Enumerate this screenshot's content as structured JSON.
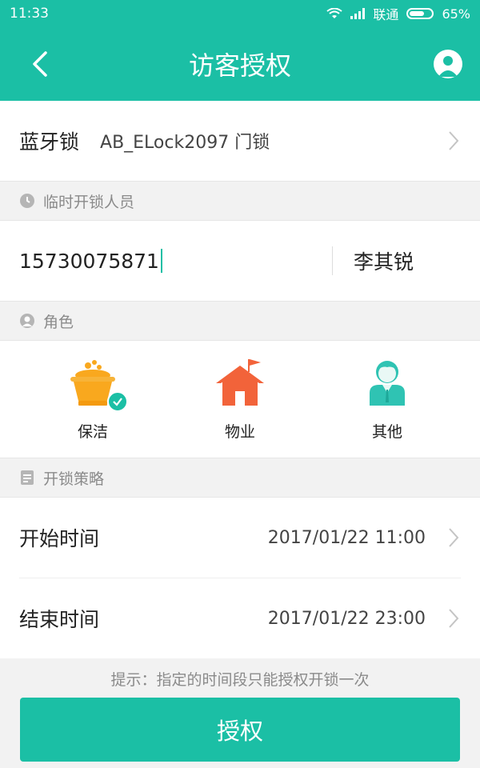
{
  "status_bar": {
    "time": "11:33",
    "carrier": "联通",
    "battery": "65%"
  },
  "header": {
    "title": "访客授权"
  },
  "lock": {
    "label": "蓝牙锁",
    "value": "AB_ELock2097 门锁"
  },
  "temp_person": {
    "section_title": "临时开锁人员",
    "phone": "15730075871",
    "name": "李其锐"
  },
  "roles": {
    "section_title": "角色",
    "items": [
      {
        "label": "保洁",
        "icon": "cleaning-basin-icon",
        "selected": true
      },
      {
        "label": "物业",
        "icon": "house-flag-icon",
        "selected": false
      },
      {
        "label": "其他",
        "icon": "person-icon",
        "selected": false
      }
    ]
  },
  "strategy": {
    "section_title": "开锁策略",
    "start": {
      "label": "开始时间",
      "value": "2017/01/22 11:00"
    },
    "end": {
      "label": "结束时间",
      "value": "2017/01/22 23:00"
    }
  },
  "hint": "提示：指定的时间段只能授权开锁一次",
  "button": {
    "label": "授权"
  },
  "colors": {
    "accent": "#1bbfa5",
    "cleaning": "#f9a81e",
    "property": "#f2633a",
    "other": "#2fc3b3"
  }
}
